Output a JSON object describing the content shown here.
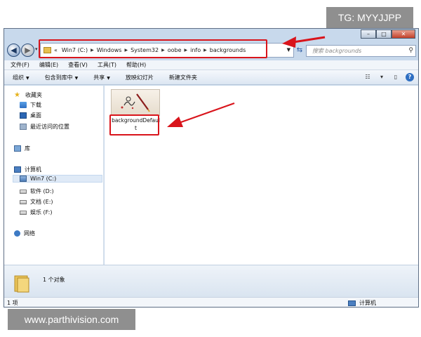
{
  "watermarks": {
    "top": "TG: MYYJJPP",
    "bottom": "www.parthivision.com"
  },
  "window_controls": {
    "minimize": "–",
    "maximize": "□",
    "close": "✕"
  },
  "navigation": {
    "back_icon": "back-arrow-icon",
    "forward_icon": "forward-arrow-icon"
  },
  "address": {
    "prefix": "«",
    "crumbs": [
      "Win7 (C:)",
      "Windows",
      "System32",
      "oobe",
      "info",
      "backgrounds"
    ]
  },
  "search": {
    "placeholder": "搜索 backgrounds"
  },
  "menu": [
    "文件(F)",
    "编辑(E)",
    "查看(V)",
    "工具(T)",
    "帮助(H)"
  ],
  "toolbar": [
    "组织",
    "包含到库中",
    "共享",
    "放映幻灯片",
    "新建文件夹"
  ],
  "sidebar": {
    "favorites": {
      "label": "收藏夹",
      "items": [
        "下载",
        "桌面",
        "最近访问的位置"
      ]
    },
    "library": {
      "label": "库"
    },
    "computer": {
      "label": "计算机",
      "drives": [
        "Win7 (C:)",
        "软件 (D:)",
        "文档 (E:)",
        "娱乐 (F:)"
      ]
    },
    "network": {
      "label": "网络"
    }
  },
  "content": {
    "file_name": "backgroundDefault"
  },
  "details": {
    "object_count": "1 个对象"
  },
  "status": {
    "items": "1 项",
    "location": "计算机"
  },
  "colors": {
    "highlight": "#d9141b",
    "window_chrome": "#c8d9ec"
  }
}
